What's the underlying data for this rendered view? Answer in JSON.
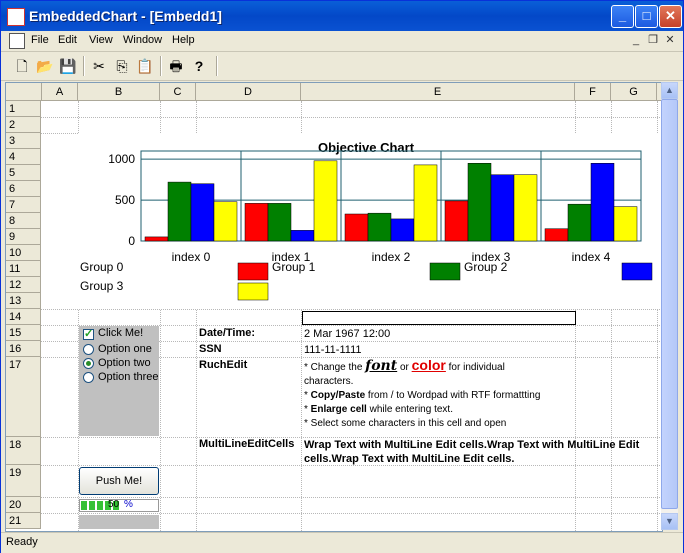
{
  "window": {
    "title": "EmbeddedChart - [Embedd1]",
    "minimize": "_",
    "maximize": "□",
    "close": "✕"
  },
  "menu": {
    "items": [
      "File",
      "Edit",
      "View",
      "Window",
      "Help"
    ],
    "mdi_min": "_",
    "mdi_restore": "❐",
    "mdi_close": "✕"
  },
  "toolbar": {
    "icons": [
      "new-file-icon",
      "open-folder-icon",
      "save-icon",
      "cut-icon",
      "copy-icon",
      "paste-icon",
      "print-icon",
      "help-icon"
    ],
    "glyphs": [
      "🗋",
      "📂",
      "💾",
      "✂",
      "⎘",
      "📋",
      "🖶",
      "?"
    ]
  },
  "grid": {
    "columns": [
      "A",
      "B",
      "C",
      "D",
      "E",
      "F",
      "G"
    ],
    "rows": [
      "1",
      "2",
      "3",
      "4",
      "5",
      "6",
      "7",
      "8",
      "9",
      "10",
      "11",
      "12",
      "13",
      "14",
      "15",
      "16",
      "17",
      "18",
      "19",
      "20",
      "21"
    ]
  },
  "chart_data": {
    "type": "bar",
    "title": "Objective Chart",
    "categories": [
      "index 0",
      "index 1",
      "index 2",
      "index 3",
      "index 4"
    ],
    "ylim": [
      0,
      1100
    ],
    "yticks": [
      "0",
      "500",
      "1000"
    ],
    "series": [
      {
        "name": "Group 0",
        "color": "#ff0000",
        "values": [
          50,
          460,
          330,
          490,
          150
        ]
      },
      {
        "name": "Group 1",
        "color": "#008000",
        "values": [
          720,
          460,
          340,
          950,
          450
        ]
      },
      {
        "name": "Group 2",
        "color": "#0000ff",
        "values": [
          700,
          130,
          270,
          810,
          950
        ]
      },
      {
        "name": "Group 3",
        "color": "#ffff00",
        "values": [
          480,
          980,
          930,
          810,
          420
        ]
      }
    ],
    "grid": true,
    "legend_position": "bottom"
  },
  "cells": {
    "checkbox_label": "Click Me!",
    "checkbox_checked": true,
    "radios": [
      "Option one",
      "Option two",
      "Option three"
    ],
    "radio_selected": 1,
    "datetime_label": "Date/Time:",
    "datetime_value": "2  Mar 1967  12:00",
    "ssn_label": "SSN",
    "ssn_value": "111-11-1111",
    "richedit_label": "RuchEdit",
    "rich_line1_pre": "* Change the ",
    "rich_font": "font",
    "rich_or": " or ",
    "rich_color": "color",
    "rich_line1_post": " for individual",
    "rich_line1_cont": "characters.",
    "rich_line2_bold": "Copy/Paste",
    "rich_line2_rest": " from / to Wordpad with RTF formattting",
    "rich_line3_bold": "Enlarge cell",
    "rich_line3_rest": " while entering text.",
    "rich_line4": "* Select some characters in this cell and open",
    "bullet": "* ",
    "multiline_label": "MultiLineEditCells",
    "multiline_line1": "Wrap Text with MultiLine Edit cells.Wrap Text with MultiLine Edit",
    "multiline_line2": "cells.Wrap Text with MultiLine Edit cells.",
    "push_button": "Push Me!",
    "progress_fraction": 0.5,
    "progress_text": "50",
    "percent_sign": "%"
  },
  "status": {
    "text": "Ready"
  }
}
